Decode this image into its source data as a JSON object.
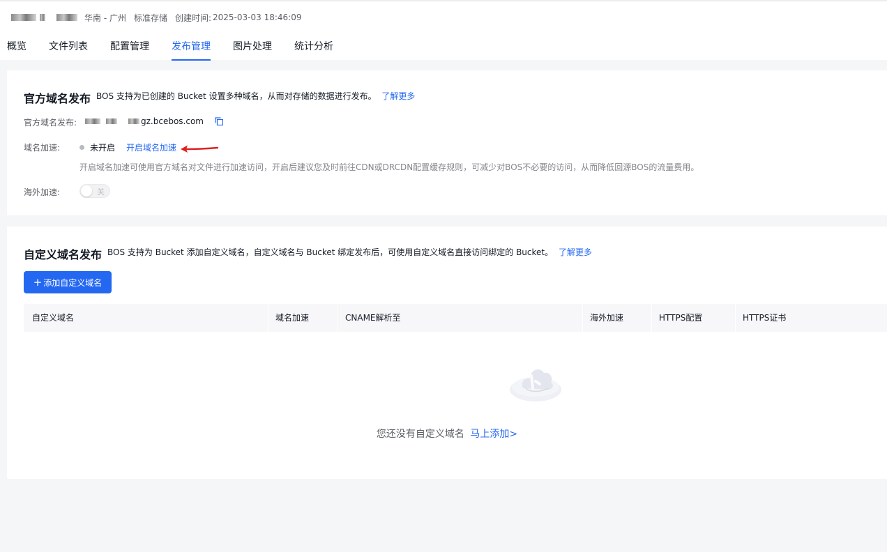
{
  "header": {
    "region": "华南 - 广州",
    "storage_class": "标准存储",
    "created_label": "创建时间:",
    "created_time": "2025-03-03 18:46:09"
  },
  "tabs": [
    {
      "label": "概览",
      "active": false
    },
    {
      "label": "文件列表",
      "active": false
    },
    {
      "label": "配置管理",
      "active": false
    },
    {
      "label": "发布管理",
      "active": true
    },
    {
      "label": "图片处理",
      "active": false
    },
    {
      "label": "统计分析",
      "active": false
    }
  ],
  "official": {
    "title": "官方域名发布",
    "desc": "BOS 支持为已创建的 Bucket 设置多种域名，从而对存储的数据进行发布。",
    "learn_more": "了解更多",
    "domain_label": "官方域名发布:",
    "domain_suffix": "gz.bcebos.com",
    "accel_label": "域名加速:",
    "accel_status": "未开启",
    "accel_action": "开启域名加速",
    "accel_hint": "开启域名加速可使用官方域名对文件进行加速访问，开启后建议您及时前往CDN或DRCDN配置缓存规则，可减少对BOS不必要的访问，从而降低回源BOS的流量费用。",
    "overseas_label": "海外加速:",
    "overseas_switch": "关"
  },
  "custom": {
    "title": "自定义域名发布",
    "desc": "BOS 支持为 Bucket 添加自定义域名，自定义域名与 Bucket 绑定发布后，可使用自定义域名直接访问绑定的 Bucket。",
    "learn_more": "了解更多",
    "add_button": "添加自定义域名",
    "columns": [
      "自定义域名",
      "域名加速",
      "CNAME解析至",
      "海外加速",
      "HTTPS配置",
      "HTTPS证书"
    ],
    "empty_text": "您还没有自定义域名",
    "empty_action": "马上添加>"
  },
  "colors": {
    "accent": "#2468f2",
    "annotation_arrow": "#e02020"
  }
}
